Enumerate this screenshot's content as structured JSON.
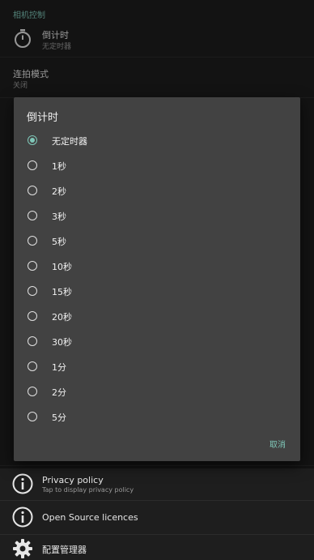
{
  "section_header": "相机控制",
  "timer_row": {
    "title": "倒计时",
    "summary": "无定时器"
  },
  "burst_row": {
    "title": "连拍模式",
    "summary": "关闭"
  },
  "privacy_row": {
    "title": "Privacy policy",
    "summary": "Tap to display privacy policy"
  },
  "licences_row": {
    "title": "Open Source licences"
  },
  "config_row": {
    "title": "配置管理器"
  },
  "dialog": {
    "title": "倒计时",
    "options": [
      "无定时器",
      "1秒",
      "2秒",
      "3秒",
      "5秒",
      "10秒",
      "15秒",
      "20秒",
      "30秒",
      "1分",
      "2分",
      "5分"
    ],
    "selected_index": 0,
    "cancel_label": "取消"
  },
  "colors": {
    "accent": "#7fc7b8",
    "dialog_bg": "#424242",
    "page_bg": "#1e1e1e"
  }
}
